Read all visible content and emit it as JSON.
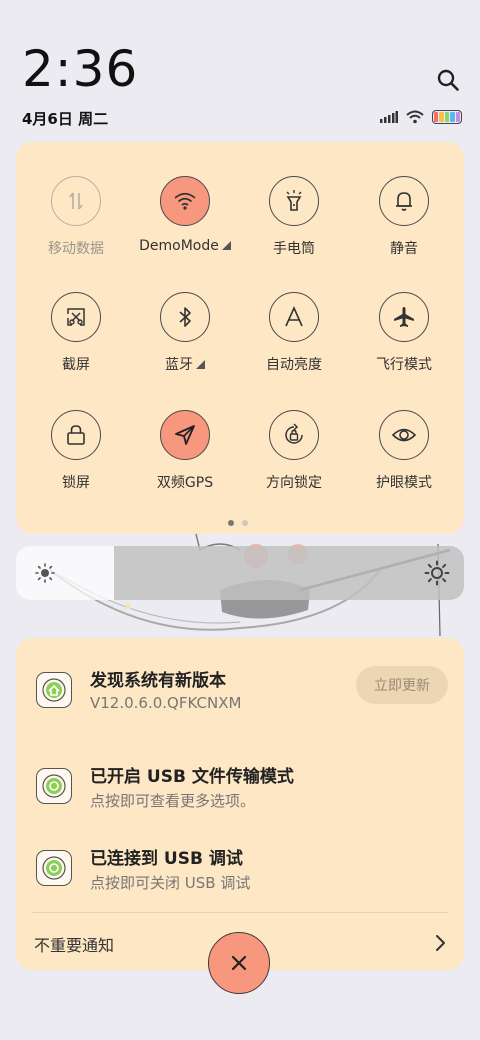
{
  "header": {
    "time": "2:36",
    "date": "4月6日 周二"
  },
  "quick_settings": {
    "tiles": [
      {
        "label": "移动数据",
        "icon": "mobile-data-icon",
        "state": "disabled"
      },
      {
        "label": "DemoMode",
        "icon": "wifi-icon",
        "state": "on",
        "has_submenu": true
      },
      {
        "label": "手电筒",
        "icon": "flashlight-icon",
        "state": "off"
      },
      {
        "label": "静音",
        "icon": "bell-icon",
        "state": "off"
      },
      {
        "label": "截屏",
        "icon": "screenshot-icon",
        "state": "off"
      },
      {
        "label": "蓝牙",
        "icon": "bluetooth-icon",
        "state": "off",
        "has_submenu": true
      },
      {
        "label": "自动亮度",
        "icon": "auto-brightness-icon",
        "state": "off"
      },
      {
        "label": "飞行模式",
        "icon": "airplane-icon",
        "state": "off"
      },
      {
        "label": "锁屏",
        "icon": "lock-icon",
        "state": "off"
      },
      {
        "label": "双频GPS",
        "icon": "gps-icon",
        "state": "on"
      },
      {
        "label": "方向锁定",
        "icon": "rotation-lock-icon",
        "state": "off"
      },
      {
        "label": "护眼模式",
        "icon": "eye-icon",
        "state": "off"
      }
    ],
    "page_count": 2,
    "current_page": 1
  },
  "brightness": {
    "level": 0.22
  },
  "notifications": {
    "items": [
      {
        "title": "发现系统有新版本",
        "subtitle": "V12.0.6.0.QFKCNXM",
        "action": "立即更新"
      },
      {
        "title": "已开启 USB 文件传输模式",
        "subtitle": "点按即可查看更多选项。"
      },
      {
        "title": "已连接到 USB 调试",
        "subtitle": "点按即可关闭 USB 调试"
      }
    ],
    "unimportant_label": "不重要通知"
  },
  "colors": {
    "panel": "#fde7c4",
    "accent_on": "#f7977e",
    "background": "#ecebf1"
  }
}
